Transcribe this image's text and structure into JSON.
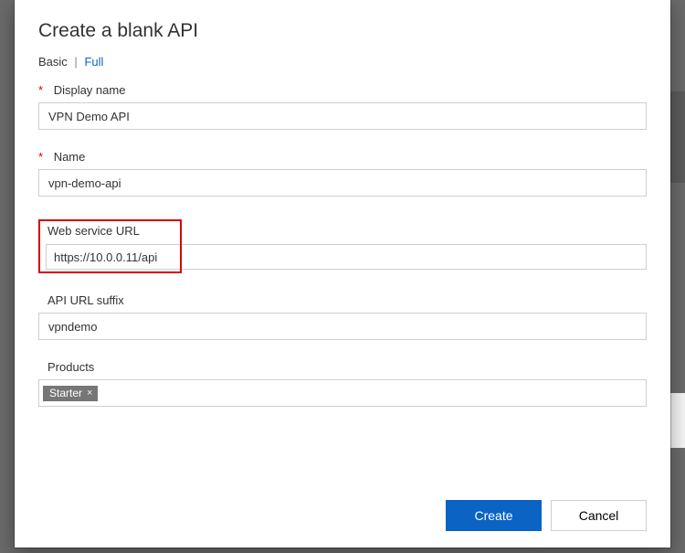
{
  "modal": {
    "title": "Create a blank API",
    "tabs": {
      "basic": "Basic",
      "full": "Full"
    }
  },
  "fields": {
    "display_name": {
      "label": "Display name",
      "value": "VPN Demo API"
    },
    "name": {
      "label": "Name",
      "value": "vpn-demo-api"
    },
    "web_url": {
      "label": "Web service URL",
      "value": "https://10.0.0.11/api"
    },
    "suffix": {
      "label": "API URL suffix",
      "value": "vpndemo"
    },
    "products": {
      "label": "Products",
      "chips": [
        "Starter"
      ]
    }
  },
  "buttons": {
    "create": "Create",
    "cancel": "Cancel"
  },
  "required_marker": "*"
}
